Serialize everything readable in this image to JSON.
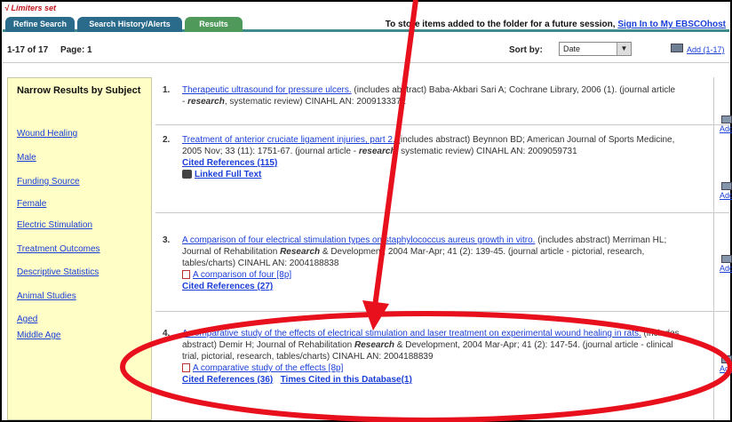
{
  "limiters_text": "√ Limiters set",
  "tabs": [
    {
      "label": "Refine Search"
    },
    {
      "label": "Search History/Alerts"
    },
    {
      "label": "Results"
    }
  ],
  "store": {
    "text": "To store items added to the folder for a future session,",
    "link": "Sign In to My EBSCOhost"
  },
  "results_bar": {
    "count": "1-17 of 17",
    "page_label": "Page: 1",
    "sort_label": "Sort by:",
    "sort_value": "Date",
    "add_all": "Add (1-17)"
  },
  "sidebar": {
    "heading": "Narrow Results by Subject",
    "subjects": [
      "Wound Healing",
      "Male",
      "Funding Source",
      "Female",
      "Electric Stimulation",
      "Treatment Outcomes",
      "Descriptive Statistics",
      "Animal Studies",
      "Aged",
      "Middle Age"
    ]
  },
  "add_label": "Add",
  "results": [
    {
      "num": "1.",
      "title": "Therapeutic ultrasound for pressure ulcers.",
      "pre": " (includes abstract) Baba-Akbari Sari A; Cochrane Library, 2006 (1). (journal article - ",
      "em": "research",
      "post": ", systematic review) CINAHL AN: 2009133372"
    },
    {
      "num": "2.",
      "title": "Treatment of anterior cruciate ligament injuries, part 2.",
      "pre": " (includes abstract) Beynnon BD; American Journal of Sports Medicine, 2005 Nov; 33 (11): 1751-67. (journal article - ",
      "em": "research",
      "post": ", systematic review) CINAHL AN: 2009059731",
      "cited": "Cited References (115)",
      "fulltext": "Linked Full Text"
    },
    {
      "num": "3.",
      "title": "A comparison of four electrical stimulation types on staphylococcus aureus growth in vitro.",
      "pre": " (includes abstract) Merriman HL; Journal of Rehabilitation ",
      "em": "Research",
      "post": " & Development, 2004 Mar-Apr; 41 (2): 139-45. (journal article - pictorial, research, tables/charts) CINAHL AN: 2004188838",
      "pdf": "A comparison of four [8p]",
      "cited": "Cited References (27)"
    },
    {
      "num": "4.",
      "title": "A comparative study of the effects of electrical stimulation and laser treatment on experimental wound healing in rats.",
      "pre": " (includes abstract) Demir H; Journal of Rehabilitation ",
      "em": "Research",
      "post": " & Development, 2004 Mar-Apr; 41 (2): 147-54. (journal article - clinical trial, pictorial, research, tables/charts) CINAHL AN: 2004188839",
      "pdf": "A comparative study of the effects [8p]",
      "cited": "Cited References (36)",
      "times_cited": "Times Cited in this Database(1)"
    }
  ],
  "annotation_color": "#e8101c"
}
